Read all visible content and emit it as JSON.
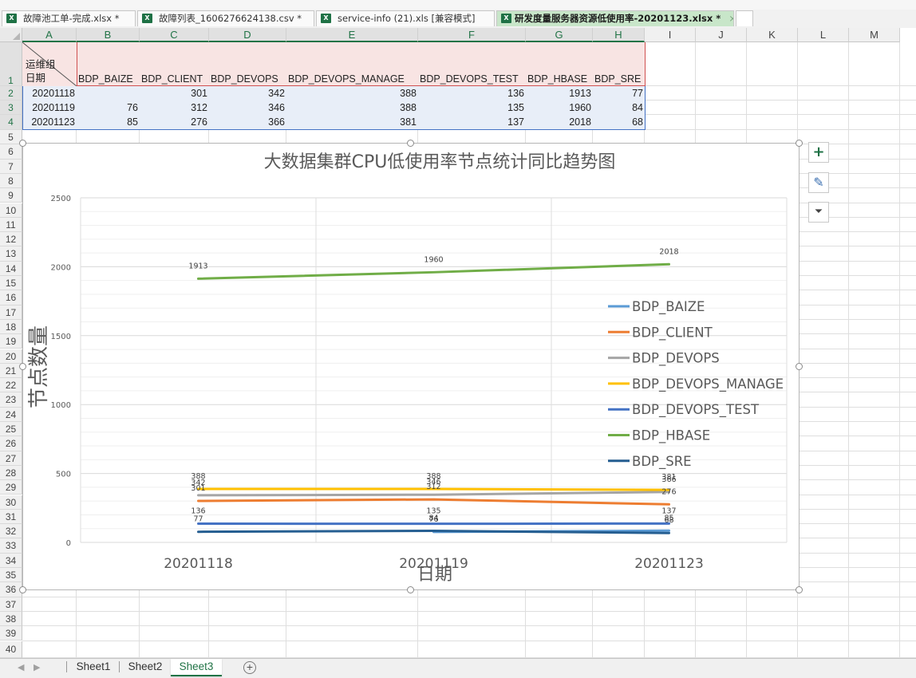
{
  "doc_tabs": [
    {
      "label": "故障池工单-完成.xlsx *",
      "active": false
    },
    {
      "label": "故障列表_1606276624138.csv *",
      "active": false
    },
    {
      "label": "service-info (21).xls  [兼容模式]",
      "active": false
    },
    {
      "label": "研发度量服务器资源低使用率-20201123.xlsx *",
      "active": true,
      "close": "×"
    }
  ],
  "columns": [
    "A",
    "B",
    "C",
    "D",
    "E",
    "F",
    "G",
    "H",
    "I",
    "J",
    "K",
    "L",
    "M"
  ],
  "rows": [
    "1",
    "2",
    "3",
    "4",
    "5",
    "6",
    "7",
    "8",
    "9",
    "10",
    "11",
    "12",
    "13",
    "14",
    "15",
    "16",
    "17",
    "18",
    "19",
    "20",
    "21",
    "22",
    "23",
    "24",
    "25",
    "26",
    "27",
    "28",
    "29",
    "30",
    "31",
    "32",
    "33",
    "34",
    "35",
    "36",
    "37",
    "38",
    "39",
    "40"
  ],
  "table": {
    "corner_top": "运维组",
    "corner_bottom": "日期",
    "headers": [
      "BDP_BAIZE",
      "BDP_CLIENT",
      "BDP_DEVOPS",
      "BDP_DEVOPS_MANAGE",
      "BDP_DEVOPS_TEST",
      "BDP_HBASE",
      "BDP_SRE"
    ],
    "data": [
      [
        "20201118",
        "",
        "301",
        "342",
        "388",
        "136",
        "1913",
        "77"
      ],
      [
        "20201119",
        "76",
        "312",
        "346",
        "388",
        "135",
        "1960",
        "84"
      ],
      [
        "20201123",
        "85",
        "276",
        "366",
        "381",
        "137",
        "2018",
        "68"
      ]
    ]
  },
  "chart_data": {
    "type": "line",
    "title": "大数据集群CPU低使用率节点统计同比趋势图",
    "xlabel": "日期",
    "ylabel": "节点数量",
    "categories": [
      "20201118",
      "20201119",
      "20201123"
    ],
    "ylim": [
      0,
      2500
    ],
    "yticks": [
      0,
      500,
      1000,
      1500,
      2000,
      2500
    ],
    "grid": true,
    "legend_position": "right",
    "series": [
      {
        "name": "BDP_BAIZE",
        "values": [
          null,
          76,
          85
        ],
        "color": "#5b9bd5"
      },
      {
        "name": "BDP_CLIENT",
        "values": [
          301,
          312,
          276
        ],
        "color": "#ed7d31"
      },
      {
        "name": "BDP_DEVOPS",
        "values": [
          342,
          346,
          366
        ],
        "color": "#a5a5a5"
      },
      {
        "name": "BDP_DEVOPS_MANAGE",
        "values": [
          388,
          388,
          381
        ],
        "color": "#ffc000"
      },
      {
        "name": "BDP_DEVOPS_TEST",
        "values": [
          136,
          135,
          137
        ],
        "color": "#4472c4"
      },
      {
        "name": "BDP_HBASE",
        "values": [
          1913,
          1960,
          2018
        ],
        "color": "#70ad47"
      },
      {
        "name": "BDP_SRE",
        "values": [
          77,
          84,
          68
        ],
        "color": "#255e91"
      }
    ]
  },
  "chart_buttons": [
    {
      "name": "chart-elements-button",
      "glyph": "+"
    },
    {
      "name": "chart-styles-button",
      "glyph": "✎"
    },
    {
      "name": "chart-filters-button",
      "glyph": "⏷"
    }
  ],
  "sheet_tabs": [
    {
      "label": "Sheet1",
      "active": false
    },
    {
      "label": "Sheet2",
      "active": false
    },
    {
      "label": "Sheet3",
      "active": true
    }
  ],
  "add_sheet": "+"
}
